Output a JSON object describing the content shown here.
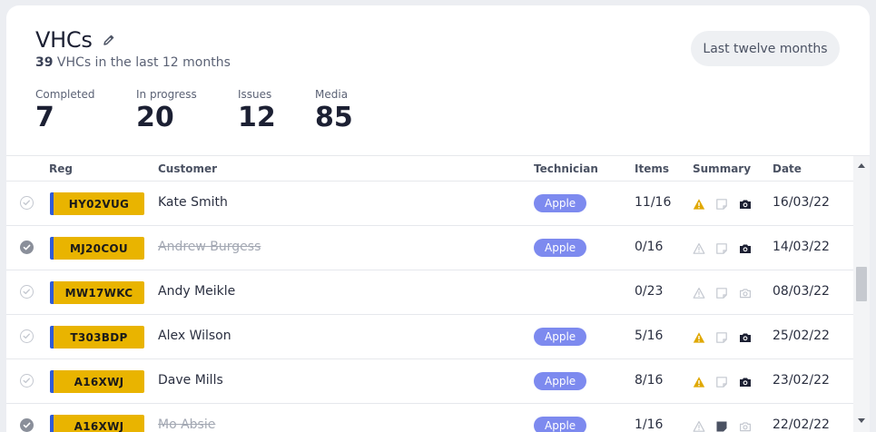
{
  "header": {
    "title": "VHCs",
    "subtitle_count": "39",
    "subtitle_text": " VHCs in the last 12 months",
    "range_button": "Last twelve months"
  },
  "stats": [
    {
      "label": "Completed",
      "value": "7"
    },
    {
      "label": "In progress",
      "value": "20"
    },
    {
      "label": "Issues",
      "value": "12"
    },
    {
      "label": "Media",
      "value": "85"
    }
  ],
  "table": {
    "columns": [
      "Reg",
      "Customer",
      "Technician",
      "Items",
      "Summary",
      "Date"
    ],
    "rows": [
      {
        "reg": "HY02VUG",
        "customer": "Kate Smith",
        "technician": "Apple",
        "items": "11/16",
        "date": "16/03/22",
        "checked": false,
        "struck": false,
        "warn": true,
        "note": false,
        "camera": true
      },
      {
        "reg": "MJ20COU",
        "customer": "Andrew Burgess",
        "technician": "Apple",
        "items": "0/16",
        "date": "14/03/22",
        "checked": true,
        "struck": true,
        "warn": false,
        "note": false,
        "camera": true
      },
      {
        "reg": "MW17WKC",
        "customer": "Andy Meikle",
        "technician": "",
        "items": "0/23",
        "date": "08/03/22",
        "checked": false,
        "struck": false,
        "warn": false,
        "note": false,
        "camera": false
      },
      {
        "reg": "T303BDP",
        "customer": "Alex Wilson",
        "technician": "Apple",
        "items": "5/16",
        "date": "25/02/22",
        "checked": false,
        "struck": false,
        "warn": true,
        "note": false,
        "camera": true
      },
      {
        "reg": "A16XWJ",
        "customer": "Dave Mills",
        "technician": "Apple",
        "items": "8/16",
        "date": "23/02/22",
        "checked": false,
        "struck": false,
        "warn": true,
        "note": false,
        "camera": true
      },
      {
        "reg": "A16XWJ",
        "customer": "Mo Absie",
        "technician": "Apple",
        "items": "1/16",
        "date": "22/02/22",
        "checked": true,
        "struck": true,
        "warn": false,
        "note": true,
        "camera": false
      }
    ]
  },
  "colors": {
    "plate": "#e9b400",
    "plate_stripe": "#2f5bd6",
    "tech_badge": "#7d8aef",
    "warning": "#e0a800"
  },
  "icons": {
    "edit": "pencil-icon",
    "check": "check-circle-icon",
    "warning": "warning-triangle-icon",
    "note": "note-icon",
    "camera": "camera-icon"
  }
}
